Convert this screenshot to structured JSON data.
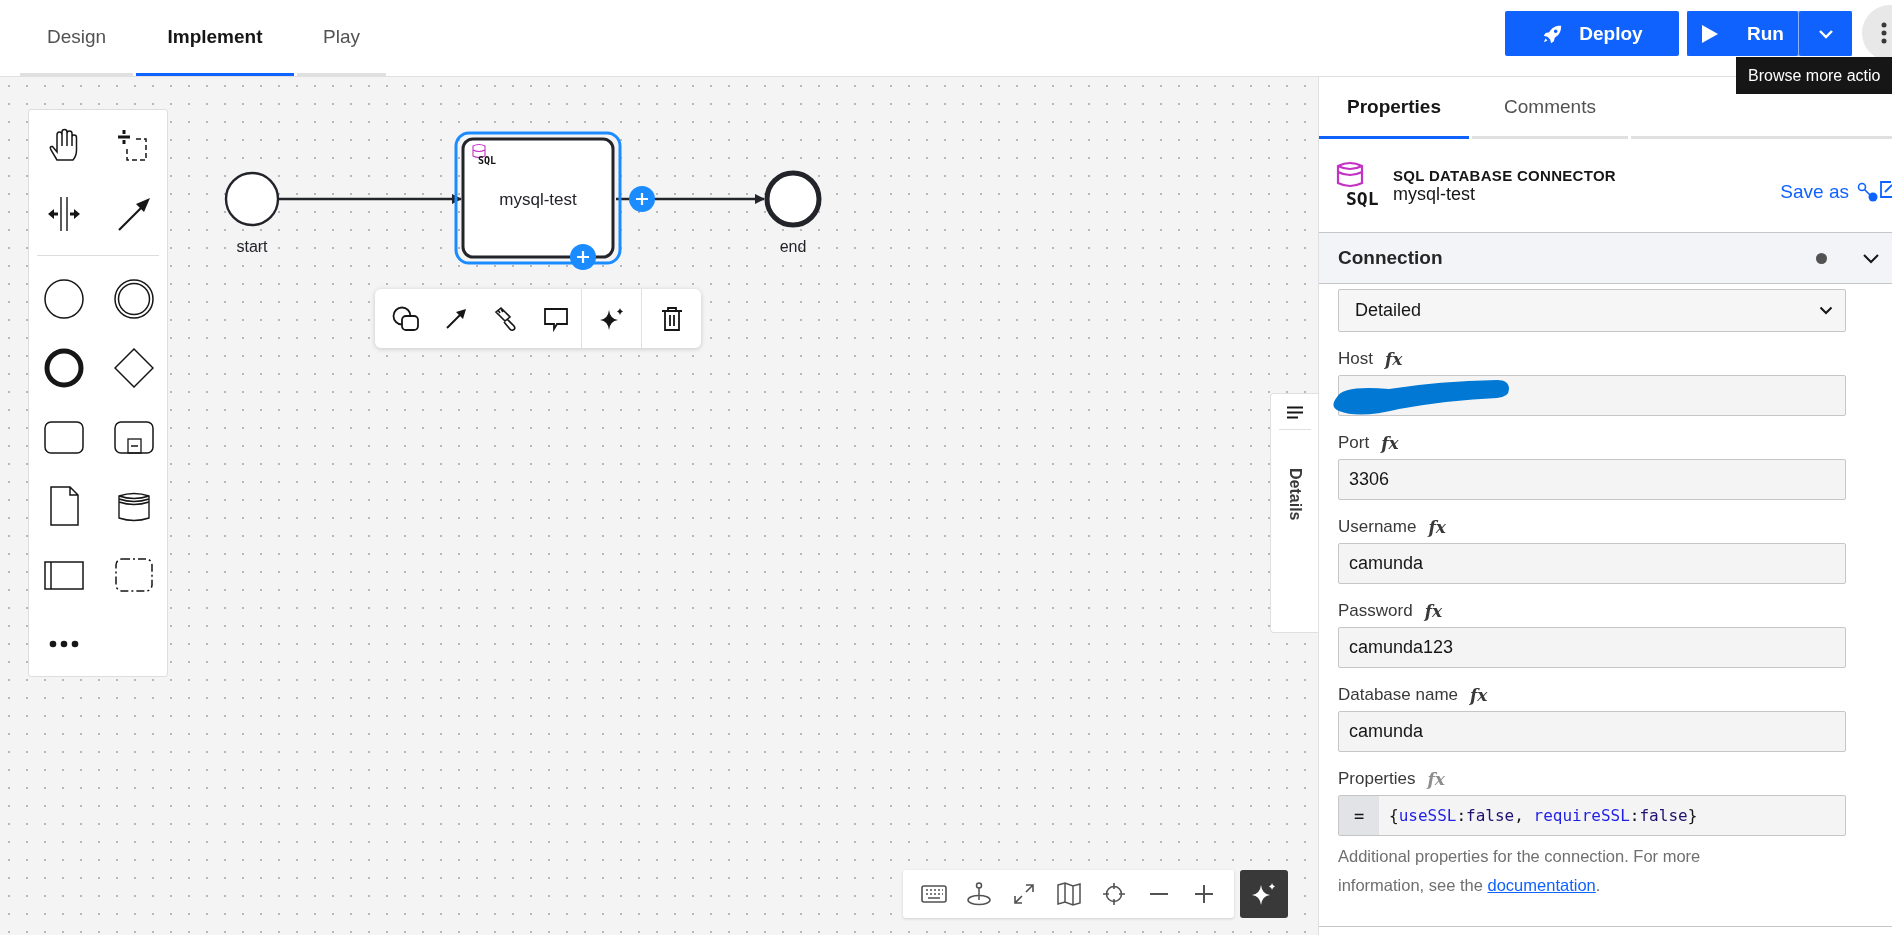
{
  "header": {
    "tabs": [
      {
        "label": "Design",
        "selected": false
      },
      {
        "label": "Implement",
        "selected": true
      },
      {
        "label": "Play",
        "selected": false
      }
    ],
    "deploy_button": "Deploy",
    "run_button": "Run",
    "tooltip": "Browse more actio"
  },
  "diagram": {
    "nodes": [
      {
        "kind": "start",
        "label": "start"
      },
      {
        "kind": "task",
        "label": "mysql-test",
        "badge": "SQL",
        "selected": true
      },
      {
        "kind": "end",
        "label": "end"
      }
    ]
  },
  "details_tab": "Details",
  "panel": {
    "tabs": [
      {
        "label": "Properties",
        "selected": true
      },
      {
        "label": "Comments",
        "selected": false
      }
    ],
    "type_icon_text": "SQL",
    "element_type": "SQL DATABASE CONNECTOR",
    "element_name": "mysql-test",
    "save_as": "Save as",
    "group": {
      "title": "Connection",
      "expanded": true,
      "changed": true
    },
    "mode": "Detailed",
    "fields": [
      {
        "label": "Host",
        "feel": "fx",
        "feel_required": false,
        "redacted": true
      },
      {
        "label": "Port",
        "feel": "fx",
        "feel_required": false,
        "value": "3306"
      },
      {
        "label": "Username",
        "feel": "fx",
        "feel_required": false,
        "value": "camunda"
      },
      {
        "label": "Password",
        "feel": "fx",
        "feel_required": false,
        "value": "camunda123"
      },
      {
        "label": "Database name",
        "feel": "fx",
        "feel_required": false,
        "value": "camunda"
      }
    ],
    "properties_field": {
      "label": "Properties",
      "feel": "fx",
      "feel_required": true,
      "prefix": "=",
      "tokens": [
        {
          "text": "{",
          "kind": "punct"
        },
        {
          "text": "useSSL",
          "kind": "key"
        },
        {
          "text": ":",
          "kind": "punct"
        },
        {
          "text": "false",
          "kind": "value"
        },
        {
          "text": ", ",
          "kind": "punct"
        },
        {
          "text": "requireSSL",
          "kind": "key"
        },
        {
          "text": ":",
          "kind": "punct"
        },
        {
          "text": "false",
          "kind": "value"
        },
        {
          "text": "}",
          "kind": "punct"
        }
      ]
    },
    "description": {
      "text": "Additional properties for the connection. For more information, see the ",
      "link": "documentation",
      "end": "."
    }
  }
}
